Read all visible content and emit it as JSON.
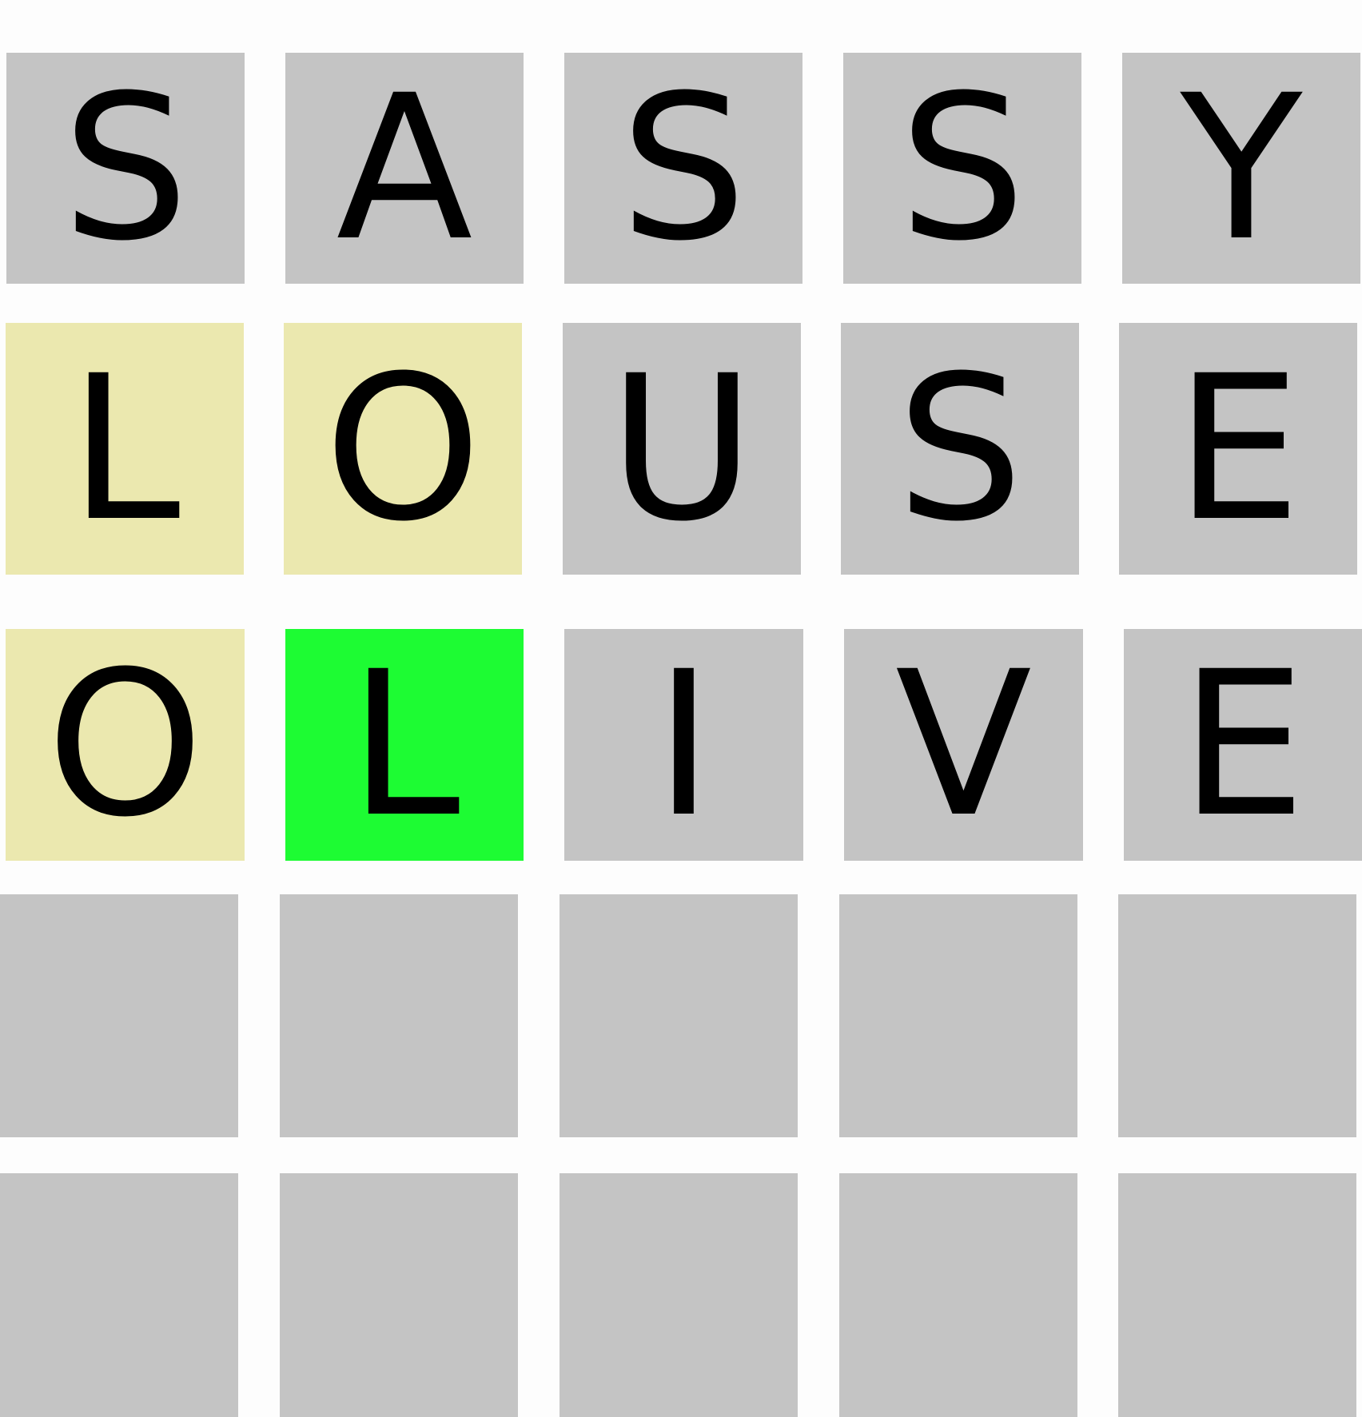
{
  "colors": {
    "absent": "#c4c4c4",
    "present": "#ebe8af",
    "correct": "#1dfc33",
    "empty": "#c4c4c4",
    "background": "#fdfdfd",
    "letter": "#000000"
  },
  "board": {
    "rows": [
      {
        "tiles": [
          {
            "letter": "S",
            "state": "absent"
          },
          {
            "letter": "A",
            "state": "absent"
          },
          {
            "letter": "S",
            "state": "absent"
          },
          {
            "letter": "S",
            "state": "absent"
          },
          {
            "letter": "Y",
            "state": "absent"
          }
        ]
      },
      {
        "tiles": [
          {
            "letter": "L",
            "state": "present"
          },
          {
            "letter": "O",
            "state": "present"
          },
          {
            "letter": "U",
            "state": "absent"
          },
          {
            "letter": "S",
            "state": "absent"
          },
          {
            "letter": "E",
            "state": "absent"
          }
        ]
      },
      {
        "tiles": [
          {
            "letter": "O",
            "state": "present"
          },
          {
            "letter": "L",
            "state": "correct"
          },
          {
            "letter": "I",
            "state": "absent"
          },
          {
            "letter": "V",
            "state": "absent"
          },
          {
            "letter": "E",
            "state": "absent"
          }
        ]
      },
      {
        "tiles": [
          {
            "letter": "",
            "state": "empty"
          },
          {
            "letter": "",
            "state": "empty"
          },
          {
            "letter": "",
            "state": "empty"
          },
          {
            "letter": "",
            "state": "empty"
          },
          {
            "letter": "",
            "state": "empty"
          }
        ]
      },
      {
        "tiles": [
          {
            "letter": "",
            "state": "empty"
          },
          {
            "letter": "",
            "state": "empty"
          },
          {
            "letter": "",
            "state": "empty"
          },
          {
            "letter": "",
            "state": "empty"
          },
          {
            "letter": "",
            "state": "empty"
          }
        ]
      }
    ]
  }
}
